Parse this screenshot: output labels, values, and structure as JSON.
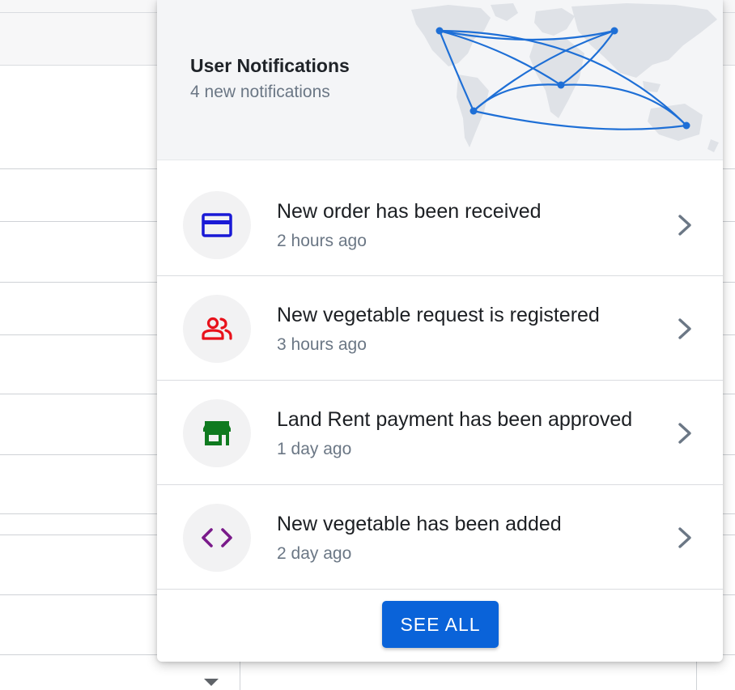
{
  "notifications_panel": {
    "title": "User Notifications",
    "subtitle": "4 new notifications",
    "see_all_label": "SEE ALL",
    "accent_color": "#0a63d9",
    "items": [
      {
        "title": "New order has been received",
        "time": "2 hours ago",
        "icon": "credit-card-icon",
        "icon_color": "#1a1ad6"
      },
      {
        "title": "New vegetable request is registered",
        "time": "3 hours ago",
        "icon": "users-icon",
        "icon_color": "#e8121b"
      },
      {
        "title": "Land Rent payment has been approved",
        "time": "1 day ago",
        "icon": "store-icon",
        "icon_color": "#0f7a1f"
      },
      {
        "title": "New vegetable has been added",
        "time": "2 day ago",
        "icon": "code-icon",
        "icon_color": "#7a1a8a"
      }
    ]
  }
}
